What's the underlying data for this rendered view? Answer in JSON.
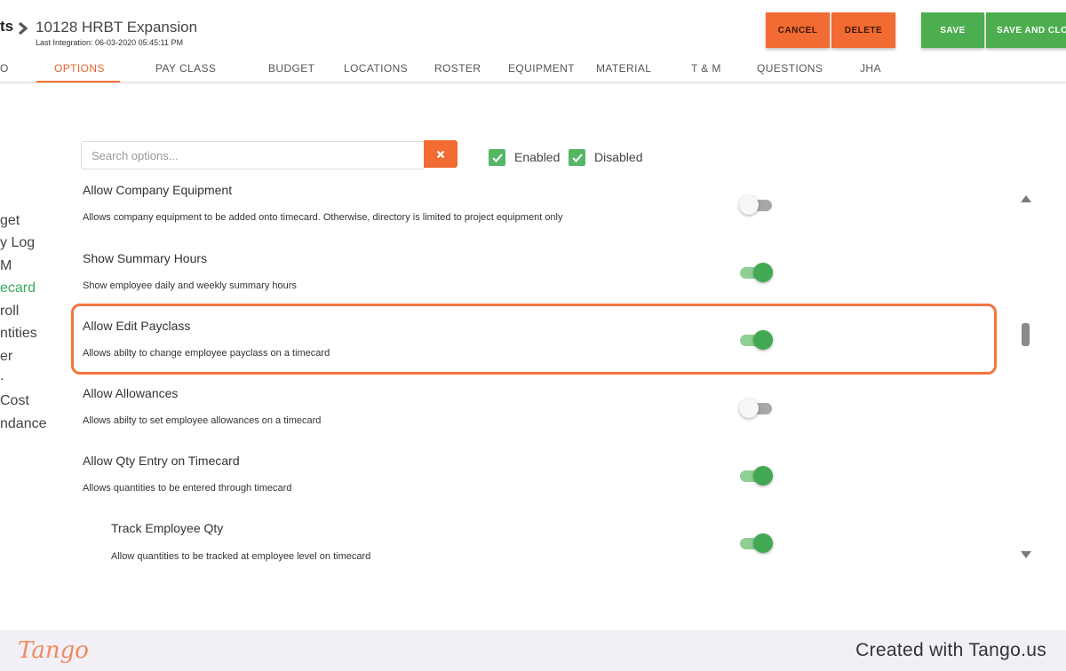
{
  "header": {
    "breadcrumb_tail": "ts",
    "project_title": "10128 HRBT Expansion",
    "last_integration": "Last Integration: 06-03-2020 05:45:11 PM"
  },
  "actions": {
    "cancel": "CANCEL",
    "delete": "DELETE",
    "save": "SAVE",
    "save_and_close": "SAVE AND CLO"
  },
  "tabs": [
    {
      "label": "O"
    },
    {
      "label": "OPTIONS"
    },
    {
      "label": "PAY CLASS"
    },
    {
      "label": "BUDGET"
    },
    {
      "label": "LOCATIONS"
    },
    {
      "label": "ROSTER"
    },
    {
      "label": "EQUIPMENT"
    },
    {
      "label": "MATERIAL"
    },
    {
      "label": "T & M"
    },
    {
      "label": "QUESTIONS"
    },
    {
      "label": "JHA"
    }
  ],
  "active_tab": "OPTIONS",
  "sidebar": {
    "items": [
      {
        "label": "get"
      },
      {
        "label": "y Log"
      },
      {
        "label": "M"
      },
      {
        "label": "ecard"
      },
      {
        "label": "roll"
      },
      {
        "label": "ntities"
      },
      {
        "label": "er"
      },
      {
        "label": "."
      },
      {
        "label": " Cost"
      },
      {
        "label": "ndance"
      }
    ],
    "active_item": "ecard"
  },
  "search": {
    "placeholder": "Search options...",
    "clear_icon": "x-icon"
  },
  "filters": {
    "enabled_label": "Enabled",
    "disabled_label": "Disabled",
    "enabled_checked": true,
    "disabled_checked": true
  },
  "options": [
    {
      "title": "Allow Company Equipment",
      "description": "Allows company equipment to be added onto timecard. Otherwise, directory is limited to project equipment only",
      "enabled": false
    },
    {
      "title": "Show Summary Hours",
      "description": "Show employee daily and weekly summary hours",
      "enabled": true
    },
    {
      "title": "Allow Edit Payclass",
      "description": "Allows abilty to change employee payclass on a timecard",
      "enabled": true
    },
    {
      "title": "Allow Allowances",
      "description": "Allows abilty to set employee allowances on a timecard",
      "enabled": false
    },
    {
      "title": "Allow Qty Entry on Timecard",
      "description": "Allows quantities to be entered through timecard",
      "enabled": true
    },
    {
      "title": "Track Employee Qty",
      "description": "Allow quantities to be tracked at employee level on timecard",
      "enabled": true
    }
  ],
  "footer": {
    "logo": "Tango",
    "created_with": "Created with Tango.us"
  },
  "colors": {
    "accent_orange": "#f26b32",
    "accent_green": "#4cae4f",
    "highlight": "#f5733b"
  }
}
